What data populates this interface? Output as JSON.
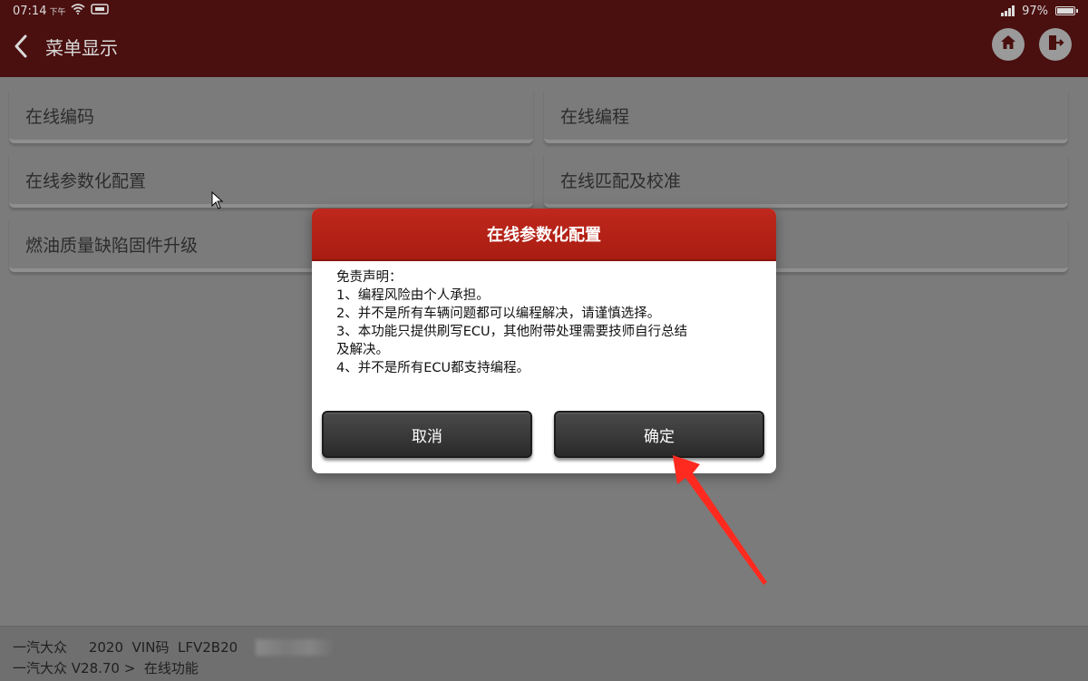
{
  "status_bar": {
    "time": "07:14",
    "ampm": "下午",
    "battery": "97%",
    "battery_level": 0.97
  },
  "header": {
    "title": "菜单显示",
    "icons": [
      "back-icon",
      "home-icon",
      "exit-icon"
    ]
  },
  "menu": {
    "items": [
      {
        "label": "在线编码"
      },
      {
        "label": "在线编程"
      },
      {
        "label": "在线参数化配置"
      },
      {
        "label": "在线匹配及校准"
      },
      {
        "label": "燃油质量缺陷固件升级"
      }
    ]
  },
  "dialog": {
    "title": "在线参数化配置",
    "lines": [
      "免责声明：",
      "1、编程风险由个人承担。",
      "2、并不是所有车辆问题都可以编程解决，请谨慎选择。",
      "3、本功能只提供刷写ECU，其他附带处理需要技师自行总结",
      "及解决。",
      "4、并不是所有ECU都支持编程。"
    ],
    "cancel_label": "取消",
    "confirm_label": "确定"
  },
  "bottom": {
    "line1": "一汽大众     2020  VIN码  LFV2B20",
    "line2": "一汽大众 V28.70 >  在线功能"
  },
  "colors": {
    "header_bg": "#4a0f0f",
    "dialog_header": "#b3221a",
    "annotation_arrow": "#ff2a1f"
  }
}
